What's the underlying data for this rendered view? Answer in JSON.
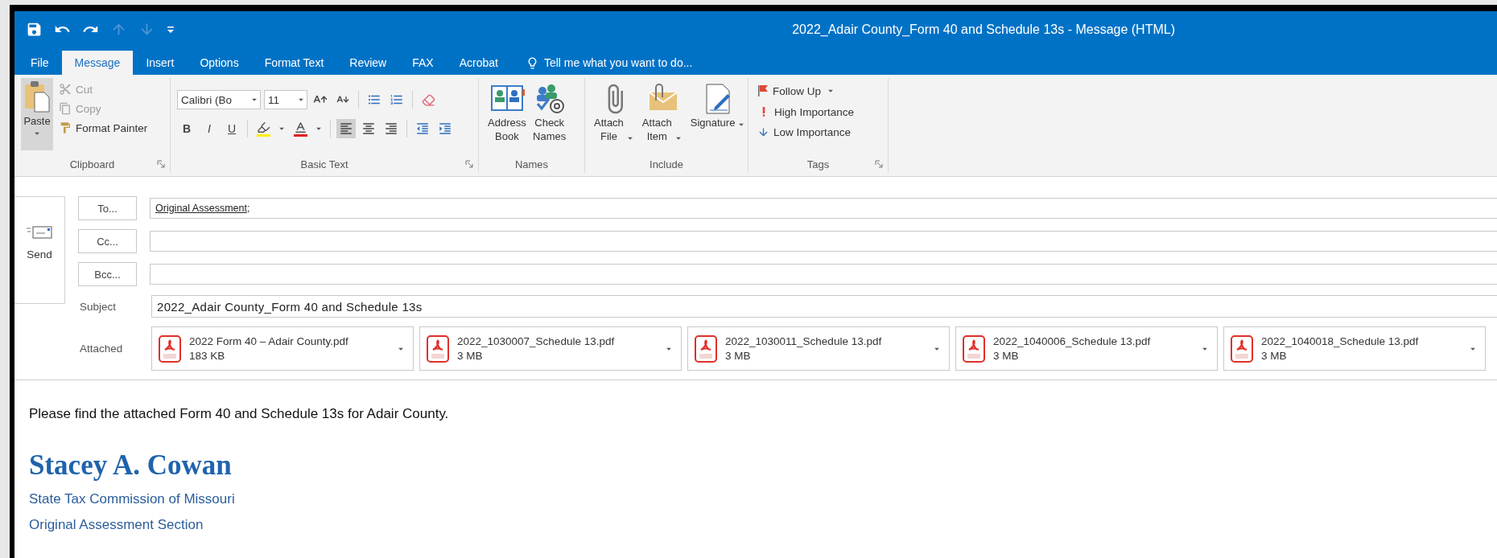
{
  "quick_access": [
    {
      "kind": "save",
      "disabled": false
    },
    {
      "kind": "undo",
      "disabled": false
    },
    {
      "kind": "redo",
      "disabled": false
    },
    {
      "kind": "up",
      "disabled": true
    },
    {
      "kind": "down",
      "disabled": true
    },
    {
      "kind": "customize",
      "disabled": false
    }
  ],
  "window": {
    "title": "2022_Adair County_Form 40 and Schedule 13s - Message (HTML)"
  },
  "tabs": [
    {
      "label": "File",
      "selected": false
    },
    {
      "label": "Message",
      "selected": true
    },
    {
      "label": "Insert",
      "selected": false
    },
    {
      "label": "Options",
      "selected": false
    },
    {
      "label": "Format Text",
      "selected": false
    },
    {
      "label": "Review",
      "selected": false
    },
    {
      "label": "FAX",
      "selected": false
    },
    {
      "label": "Acrobat",
      "selected": false
    }
  ],
  "tell_me": {
    "placeholder": "Tell me what you want to do..."
  },
  "ribbon": [
    {
      "kind": "clipboard",
      "label": "Clipboard",
      "launcher": true,
      "items": [
        {
          "kind": "paste",
          "label": "Paste"
        },
        {
          "kind": "cut",
          "label": "Cut",
          "disabled": true
        },
        {
          "kind": "copy",
          "label": "Copy",
          "disabled": true
        },
        {
          "kind": "format_painter",
          "label": "Format Painter",
          "disabled": false
        }
      ]
    },
    {
      "kind": "basic_text",
      "label": "Basic Text",
      "launcher": true,
      "font": "Calibri (Bo",
      "size": "11",
      "styles": [
        {
          "kind": "bold",
          "label": "B"
        },
        {
          "kind": "italic",
          "label": "I"
        },
        {
          "kind": "underline",
          "label": "U"
        }
      ],
      "alignment": [
        {
          "kind": "left",
          "selected": true
        },
        {
          "kind": "center",
          "selected": false
        },
        {
          "kind": "right",
          "selected": false
        }
      ]
    },
    {
      "kind": "names",
      "label": "Names",
      "launcher": false,
      "items": [
        {
          "kind": "address_book",
          "label": "Address Book",
          "dropdown": false
        },
        {
          "kind": "check_names",
          "label": "Check Names",
          "dropdown": false
        }
      ]
    },
    {
      "kind": "include",
      "label": "Include",
      "launcher": false,
      "items": [
        {
          "kind": "attach_file",
          "label": "Attach File",
          "dropdown": true
        },
        {
          "kind": "attach_item",
          "label": "Attach Item",
          "dropdown": true
        },
        {
          "kind": "signature",
          "label": "Signature",
          "dropdown": true
        }
      ]
    },
    {
      "kind": "tags",
      "label": "Tags",
      "launcher": true,
      "items": [
        {
          "kind": "follow_up",
          "label": "Follow Up",
          "dropdown": true
        },
        {
          "kind": "high_importance",
          "label": "High Importance",
          "dropdown": false
        },
        {
          "kind": "low_importance",
          "label": "Low Importance",
          "dropdown": false
        }
      ]
    }
  ],
  "send": {
    "label": "Send"
  },
  "recipients": [
    {
      "label": "To...",
      "entries": [
        {
          "name": "Original Assessment",
          "separator": ";"
        }
      ]
    },
    {
      "label": "Cc..."
    },
    {
      "label": "Bcc..."
    }
  ],
  "subject": {
    "label": "Subject",
    "value": "2022_Adair County_Form 40 and Schedule 13s"
  },
  "attached": {
    "label": "Attached",
    "files": [
      {
        "name": "2022 Form 40 – Adair County.pdf",
        "size": "183 KB"
      },
      {
        "name": "2022_1030007_Schedule 13.pdf",
        "size": "3 MB"
      },
      {
        "name": "2022_1030011_Schedule 13.pdf",
        "size": "3 MB"
      },
      {
        "name": "2022_1040006_Schedule 13.pdf",
        "size": "3 MB"
      },
      {
        "name": "2022_1040018_Schedule 13.pdf",
        "size": "3 MB"
      }
    ]
  },
  "body": {
    "paragraph": "Please find the attached Form 40 and Schedule 13s for Adair County.",
    "signature_name": "Stacey A. Cowan",
    "signature_lines": [
      "State Tax Commission of Missouri",
      "Original Assessment Section"
    ]
  }
}
